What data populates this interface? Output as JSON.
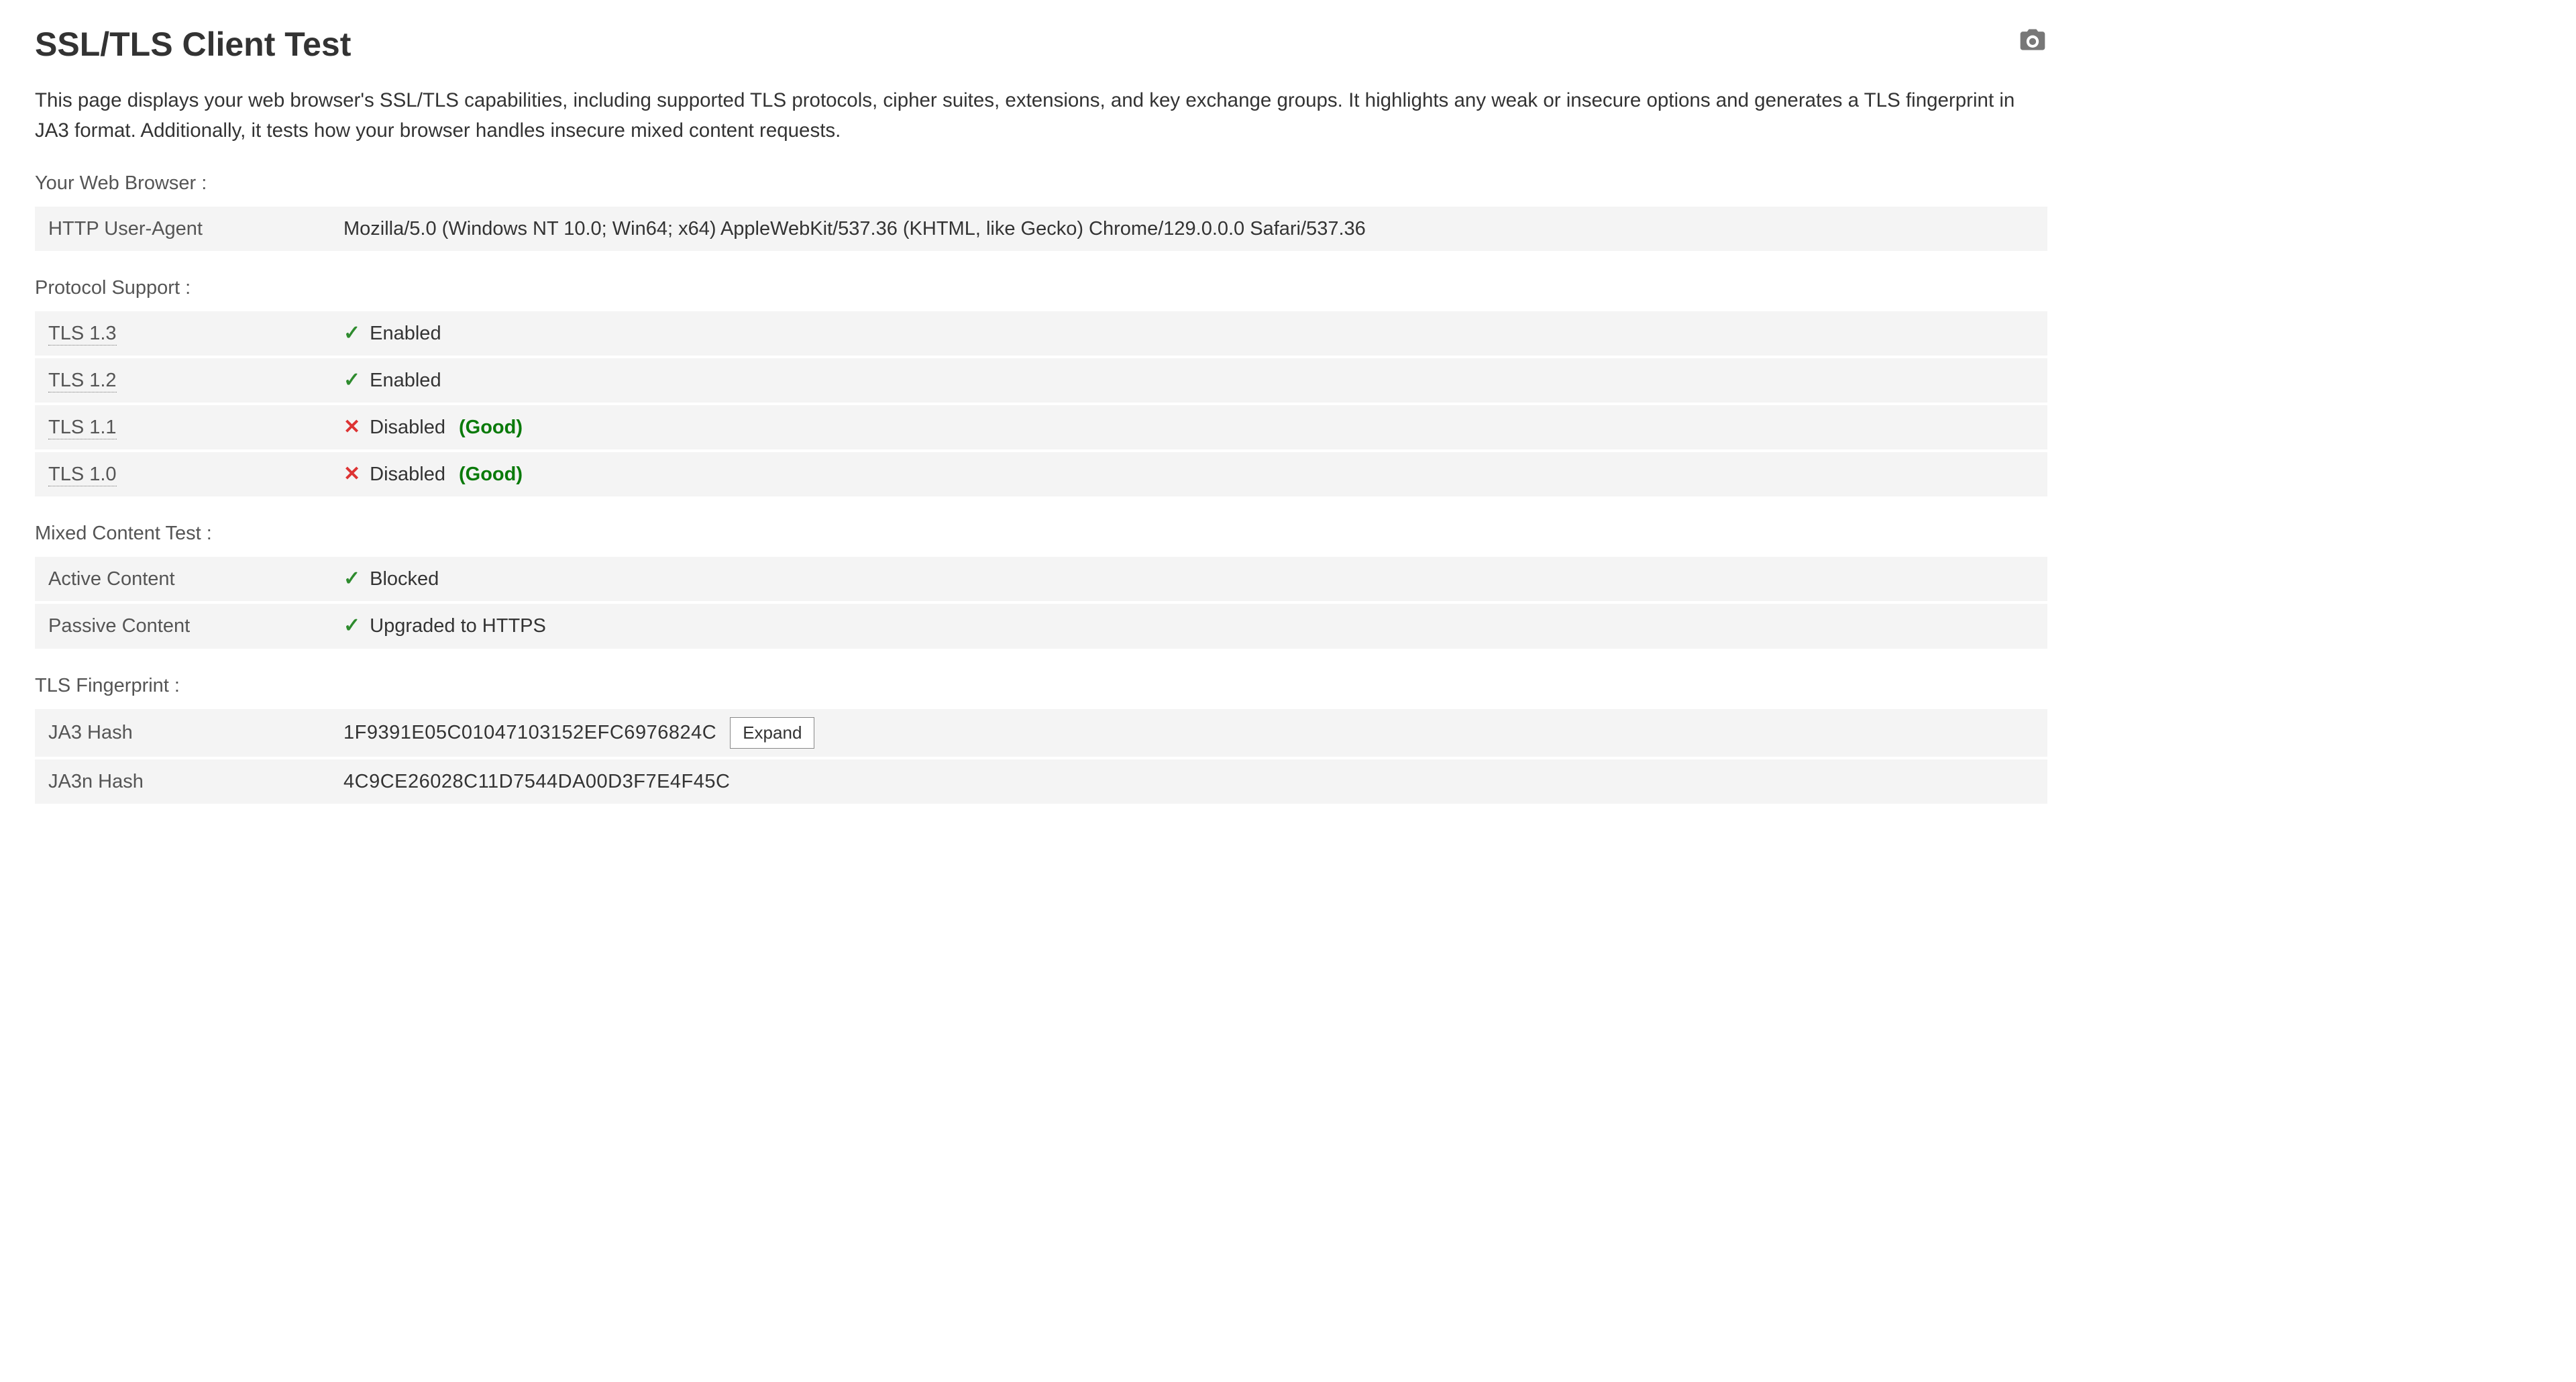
{
  "header": {
    "title": "SSL/TLS Client Test",
    "camera_icon": "camera"
  },
  "intro": "This page displays your web browser's SSL/TLS capabilities, including supported TLS protocols, cipher suites, extensions, and key exchange groups. It highlights any weak or insecure options and generates a TLS fingerprint in JA3 format. Additionally, it tests how your browser handles insecure mixed content requests.",
  "sections": {
    "browser": {
      "label": "Your Web Browser :",
      "rows": [
        {
          "key": "HTTP User-Agent",
          "value": "Mozilla/5.0 (Windows NT 10.0; Win64; x64) AppleWebKit/537.36 (KHTML, like Gecko) Chrome/129.0.0.0 Safari/537.36",
          "dotted": false
        }
      ]
    },
    "protocol": {
      "label": "Protocol Support :",
      "rows": [
        {
          "key": "TLS 1.3",
          "dotted": true,
          "icon": "check",
          "status": "Enabled",
          "note": ""
        },
        {
          "key": "TLS 1.2",
          "dotted": true,
          "icon": "check",
          "status": "Enabled",
          "note": ""
        },
        {
          "key": "TLS 1.1",
          "dotted": true,
          "icon": "cross",
          "status": "Disabled",
          "note": "(Good)"
        },
        {
          "key": "TLS 1.0",
          "dotted": true,
          "icon": "cross",
          "status": "Disabled",
          "note": "(Good)"
        }
      ]
    },
    "mixed": {
      "label": "Mixed Content Test :",
      "rows": [
        {
          "key": "Active Content",
          "dotted": false,
          "icon": "check",
          "status": "Blocked",
          "note": ""
        },
        {
          "key": "Passive Content",
          "dotted": false,
          "icon": "check",
          "status": "Upgraded to HTTPS",
          "note": ""
        }
      ]
    },
    "fingerprint": {
      "label": "TLS Fingerprint :",
      "rows": [
        {
          "key": "JA3 Hash",
          "value": "1F9391E05C01047103152EFC6976824C",
          "expand": true,
          "expand_label": "Expand"
        },
        {
          "key": "JA3n Hash",
          "value": "4C9CE26028C11D7544DA00D3F7E4F45C",
          "expand": false
        }
      ]
    }
  },
  "icons": {
    "check": "✓",
    "cross": "✕"
  }
}
